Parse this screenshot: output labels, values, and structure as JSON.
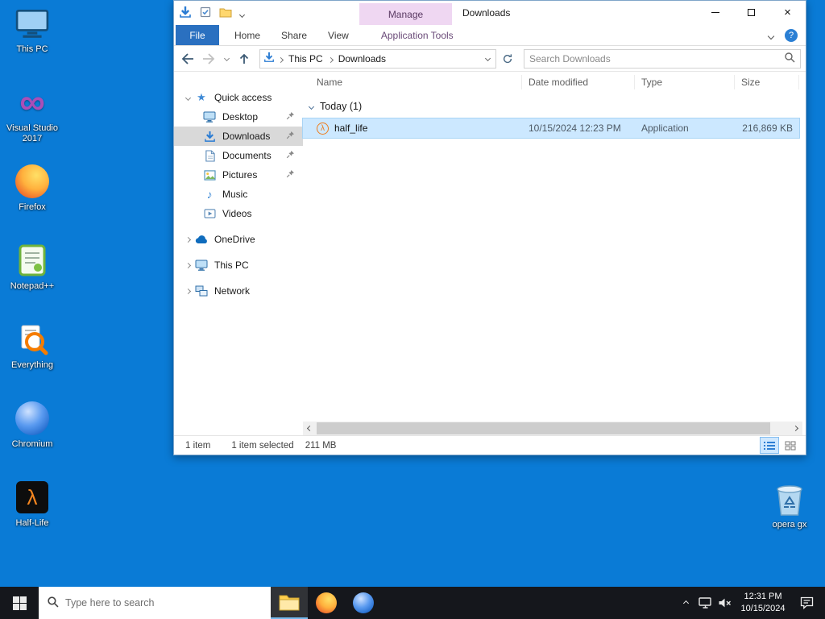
{
  "desktop": {
    "icons": [
      {
        "label": "This PC"
      },
      {
        "label": "Visual Studio 2017"
      },
      {
        "label": "Firefox"
      },
      {
        "label": "Notepad++"
      },
      {
        "label": "Everything"
      },
      {
        "label": "Chromium"
      },
      {
        "label": "Half-Life"
      }
    ],
    "recycle_bin_label": "opera gx"
  },
  "explorer": {
    "title": "Downloads",
    "contextual_tab_label": "Manage",
    "tabs": [
      {
        "label": "File"
      },
      {
        "label": "Home"
      },
      {
        "label": "Share"
      },
      {
        "label": "View"
      },
      {
        "label": "Application Tools"
      }
    ],
    "breadcrumb": {
      "separator": "›",
      "segments": [
        {
          "label": "This PC"
        },
        {
          "label": "Downloads"
        }
      ]
    },
    "search": {
      "placeholder": "Search Downloads"
    },
    "sidebar": {
      "items": [
        {
          "label": "Quick access"
        },
        {
          "label": "Desktop"
        },
        {
          "label": "Downloads"
        },
        {
          "label": "Documents"
        },
        {
          "label": "Pictures"
        },
        {
          "label": "Music"
        },
        {
          "label": "Videos"
        },
        {
          "label": "OneDrive"
        },
        {
          "label": "This PC"
        },
        {
          "label": "Network"
        }
      ]
    },
    "list": {
      "columns": [
        {
          "label": "Name"
        },
        {
          "label": "Date modified"
        },
        {
          "label": "Type"
        },
        {
          "label": "Size"
        }
      ],
      "group_label": "Today (1)",
      "rows": [
        {
          "name": "half_life",
          "date_modified": "10/15/2024 12:23 PM",
          "type": "Application",
          "size": "216,869 KB"
        }
      ]
    },
    "status": {
      "item_count": "1 item",
      "selected_text": "1 item selected",
      "selected_size": "211 MB"
    },
    "window_controls": {
      "close_glyph": "×"
    }
  },
  "taskbar": {
    "search_placeholder": "Type here to search",
    "clock": {
      "time": "12:31 PM",
      "date": "10/15/2024"
    }
  },
  "glyphs": {
    "lambda": "λ",
    "infinity": "∞",
    "star": "★",
    "music_note": "♪",
    "help": "?"
  }
}
